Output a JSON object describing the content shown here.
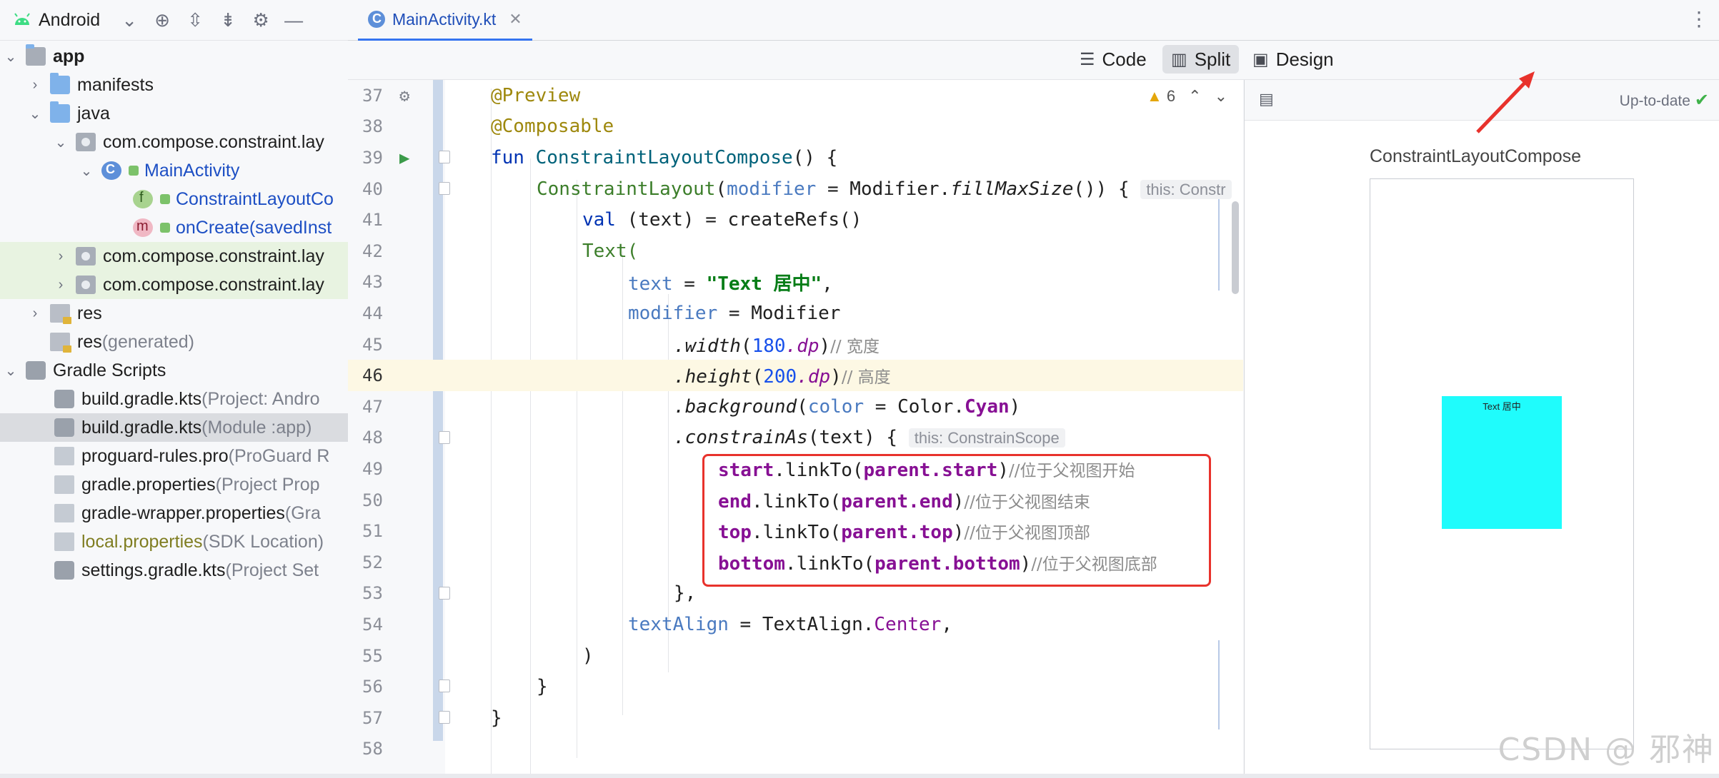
{
  "project_view": {
    "mode_label": "Android",
    "tree": [
      {
        "label": "app",
        "bold": true
      },
      {
        "label": "manifests"
      },
      {
        "label": "java"
      },
      {
        "label": "com.compose.constraint.lay"
      },
      {
        "label": "MainActivity"
      },
      {
        "label": "ConstraintLayoutCo"
      },
      {
        "label": "onCreate(savedInst"
      },
      {
        "label": "com.compose.constraint.lay"
      },
      {
        "label": "com.compose.constraint.lay"
      },
      {
        "label": "res"
      },
      {
        "label": "res",
        "suffix": " (generated)"
      },
      {
        "label": "Gradle Scripts"
      },
      {
        "label": "build.gradle.kts",
        "suffix": " (Project: Andro"
      },
      {
        "label": "build.gradle.kts",
        "suffix": " (Module :app)"
      },
      {
        "label": "proguard-rules.pro",
        "suffix": " (ProGuard R"
      },
      {
        "label": "gradle.properties",
        "suffix": " (Project Prop"
      },
      {
        "label": "gradle-wrapper.properties",
        "suffix": " (Gra"
      },
      {
        "label": "local.properties",
        "suffix": " (SDK Location)"
      },
      {
        "label": "settings.gradle.kts",
        "suffix": " (Project Set"
      }
    ]
  },
  "editor": {
    "tab_label": "MainActivity.kt",
    "modes": {
      "code": "Code",
      "split": "Split",
      "design": "Design"
    },
    "warnings_count": "6",
    "line_numbers": [
      "37",
      "38",
      "39",
      "40",
      "41",
      "42",
      "43",
      "44",
      "45",
      "46",
      "47",
      "48",
      "49",
      "50",
      "51",
      "52",
      "53",
      "54",
      "55",
      "56",
      "57",
      "58"
    ],
    "lines": {
      "l37": "@Preview",
      "l38": "@Composable",
      "l39_kw": "fun ",
      "l39_name": "ConstraintLayoutCompose",
      "l39_rest": "() {",
      "l40_call": "ConstraintLayout",
      "l40_paren": "(",
      "l40_param": "modifier",
      "l40_eq": " = Modifier.",
      "l40_fn": "fillMaxSize",
      "l40_rest": "()) {",
      "l40_hint": "this: Constr",
      "l41_kw": "val ",
      "l41_rest": "(text) = createRefs()",
      "l42": "Text(",
      "l43_param": "text",
      "l43_eq": " = ",
      "l43_str": "\"Text 居中\"",
      "l43_comma": ",",
      "l44_param": "modifier",
      "l44_rest": " = Modifier",
      "l45_fn": ".width",
      "l45_open": "(",
      "l45_num": "180",
      "l45_unit": ".dp",
      "l45_close": ")",
      "l45_cmt": "// 宽度",
      "l46_fn": ".height",
      "l46_open": "(",
      "l46_num": "200",
      "l46_unit": ".dp",
      "l46_close": ")",
      "l46_cmt": "// 高度",
      "l47_fn": ".background",
      "l47_open": "(",
      "l47_param": "color",
      "l47_eq": " = Color.",
      "l47_val": "Cyan",
      "l47_close": ")",
      "l48_fn": ".constrainAs",
      "l48_rest": "(text) {",
      "l48_hint": "this: ConstrainScope",
      "l49_a": "start",
      "l49_b": ".linkTo(",
      "l49_c": "parent.start",
      "l49_d": ")",
      "l49_cmt": "//位于父视图开始",
      "l50_a": "end",
      "l50_b": ".linkTo(",
      "l50_c": "parent.end",
      "l50_d": ")",
      "l50_cmt": "//位于父视图结束",
      "l51_a": "top",
      "l51_b": ".linkTo(",
      "l51_c": "parent.top",
      "l51_d": ")",
      "l51_cmt": "//位于父视图顶部",
      "l52_a": "bottom",
      "l52_b": ".linkTo(",
      "l52_c": "parent.bottom",
      "l52_d": ")",
      "l52_cmt": "//位于父视图底部",
      "l53": "},",
      "l54_param": "textAlign",
      "l54_rest": " = TextAlign.",
      "l54_val": "Center",
      "l54_comma": ",",
      "l55": ")",
      "l56": "}",
      "l57": "}"
    }
  },
  "preview": {
    "status": "Up-to-date",
    "title": "ConstraintLayoutCompose",
    "box_text": "Text 居中",
    "box_color": "#1ffcfc"
  },
  "watermark": "CSDN @ 邪神"
}
